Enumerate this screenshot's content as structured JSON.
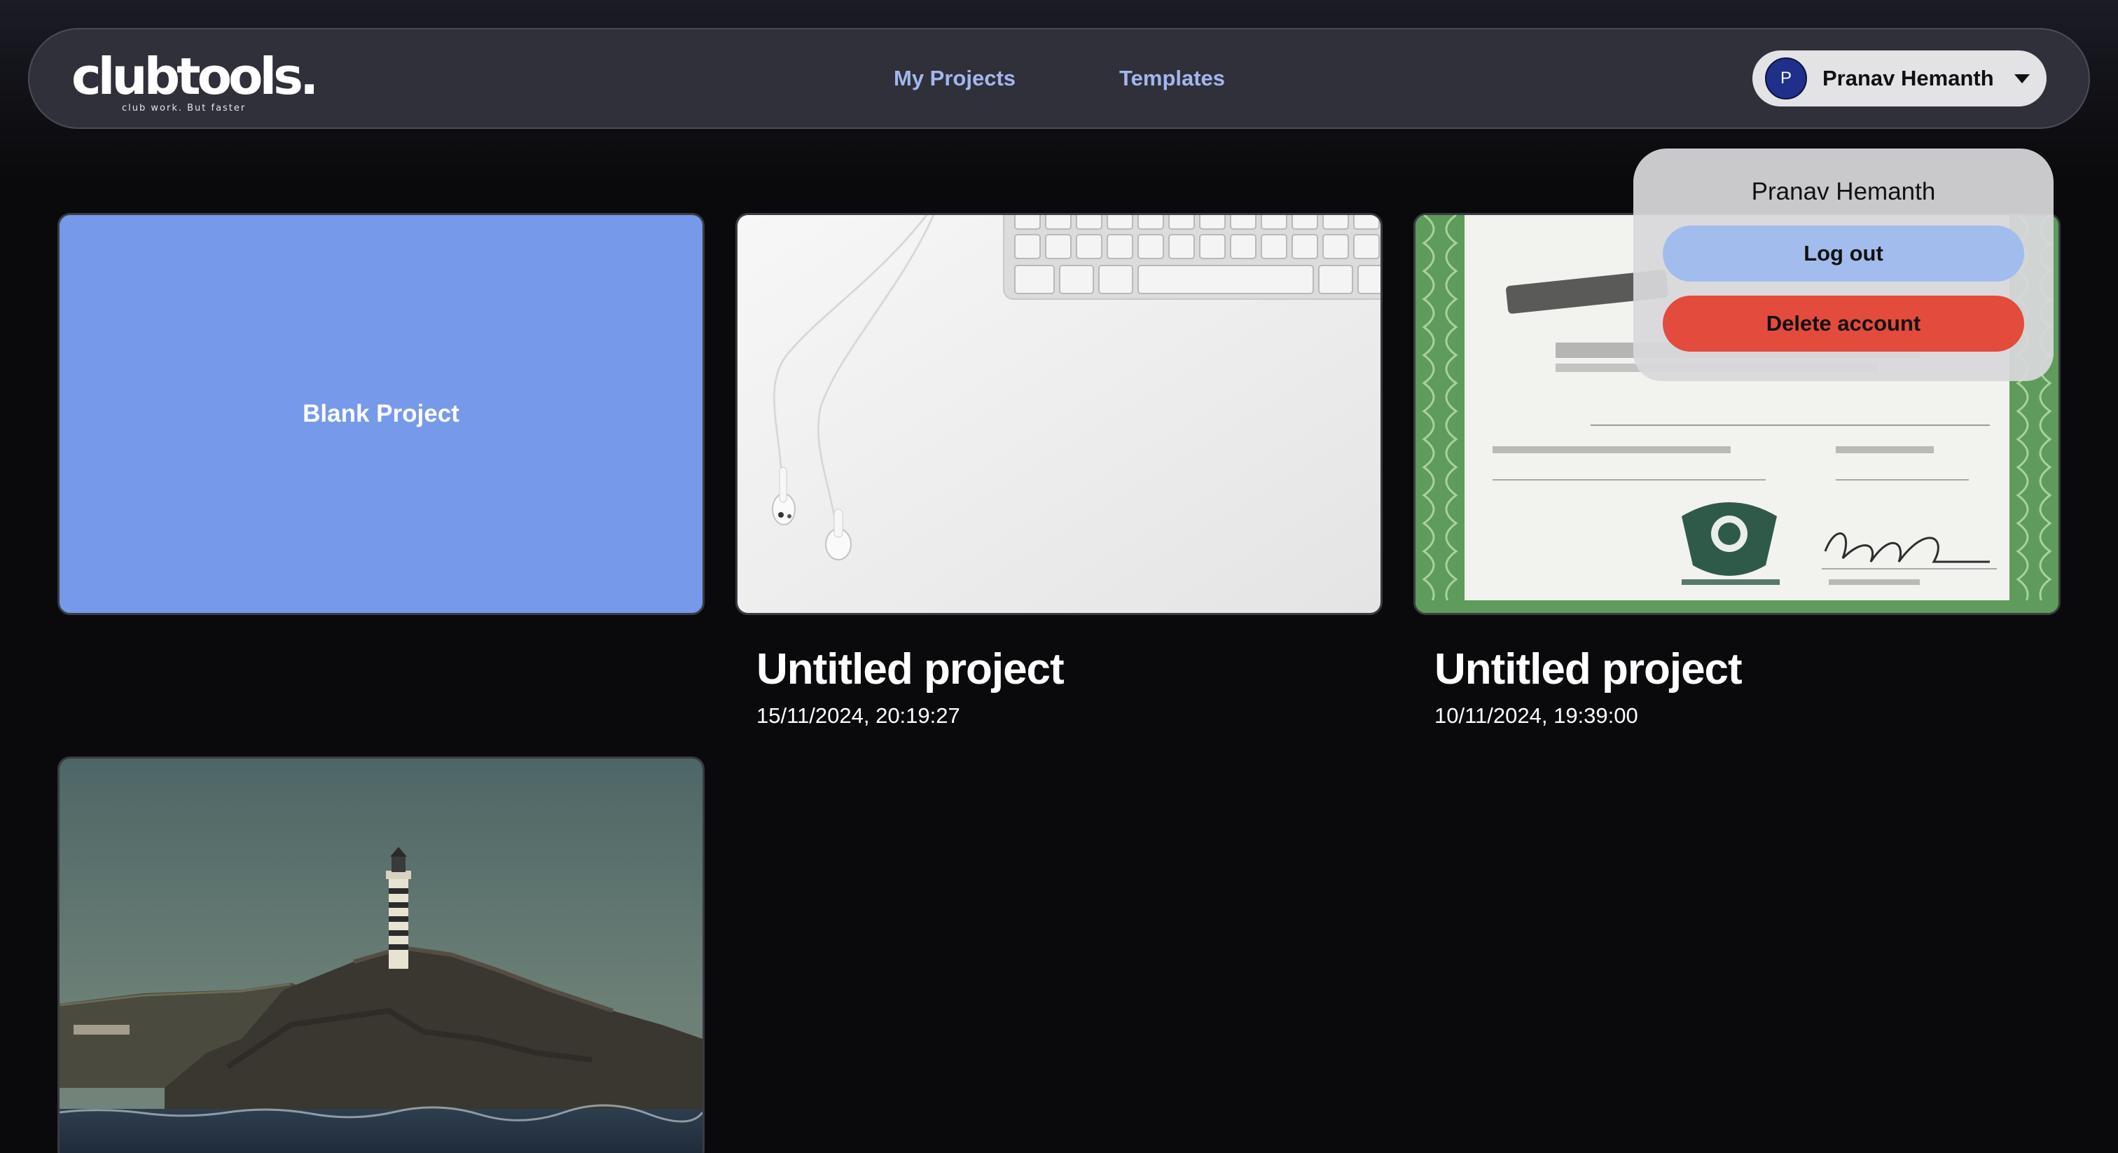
{
  "brand": {
    "logo_text": "clubtools.",
    "tagline": "club work. But faster"
  },
  "nav": {
    "links": [
      {
        "label": "My Projects"
      },
      {
        "label": "Templates"
      }
    ]
  },
  "user": {
    "avatar_initial": "P",
    "name": "Pranav Hemanth",
    "caret_icon": "caret-down-icon"
  },
  "dropdown": {
    "name": "Pranav Hemanth",
    "logout_label": "Log out",
    "delete_label": "Delete account"
  },
  "projects": {
    "blank_label": "Blank Project",
    "items": [
      {
        "title": "Untitled project",
        "date": "15/11/2024, 20:19:27",
        "thumbnail": "earphones-and-keyboard"
      },
      {
        "title": "Untitled project",
        "date": "10/11/2024, 19:39:00",
        "thumbnail": "certificate"
      },
      {
        "title": "",
        "date": "",
        "thumbnail": "lighthouse"
      }
    ]
  },
  "colors": {
    "accent_blue": "#7699e9",
    "nav_link": "#a3b6ee",
    "danger": "#e34b3c",
    "avatar": "#1f2f8a"
  }
}
